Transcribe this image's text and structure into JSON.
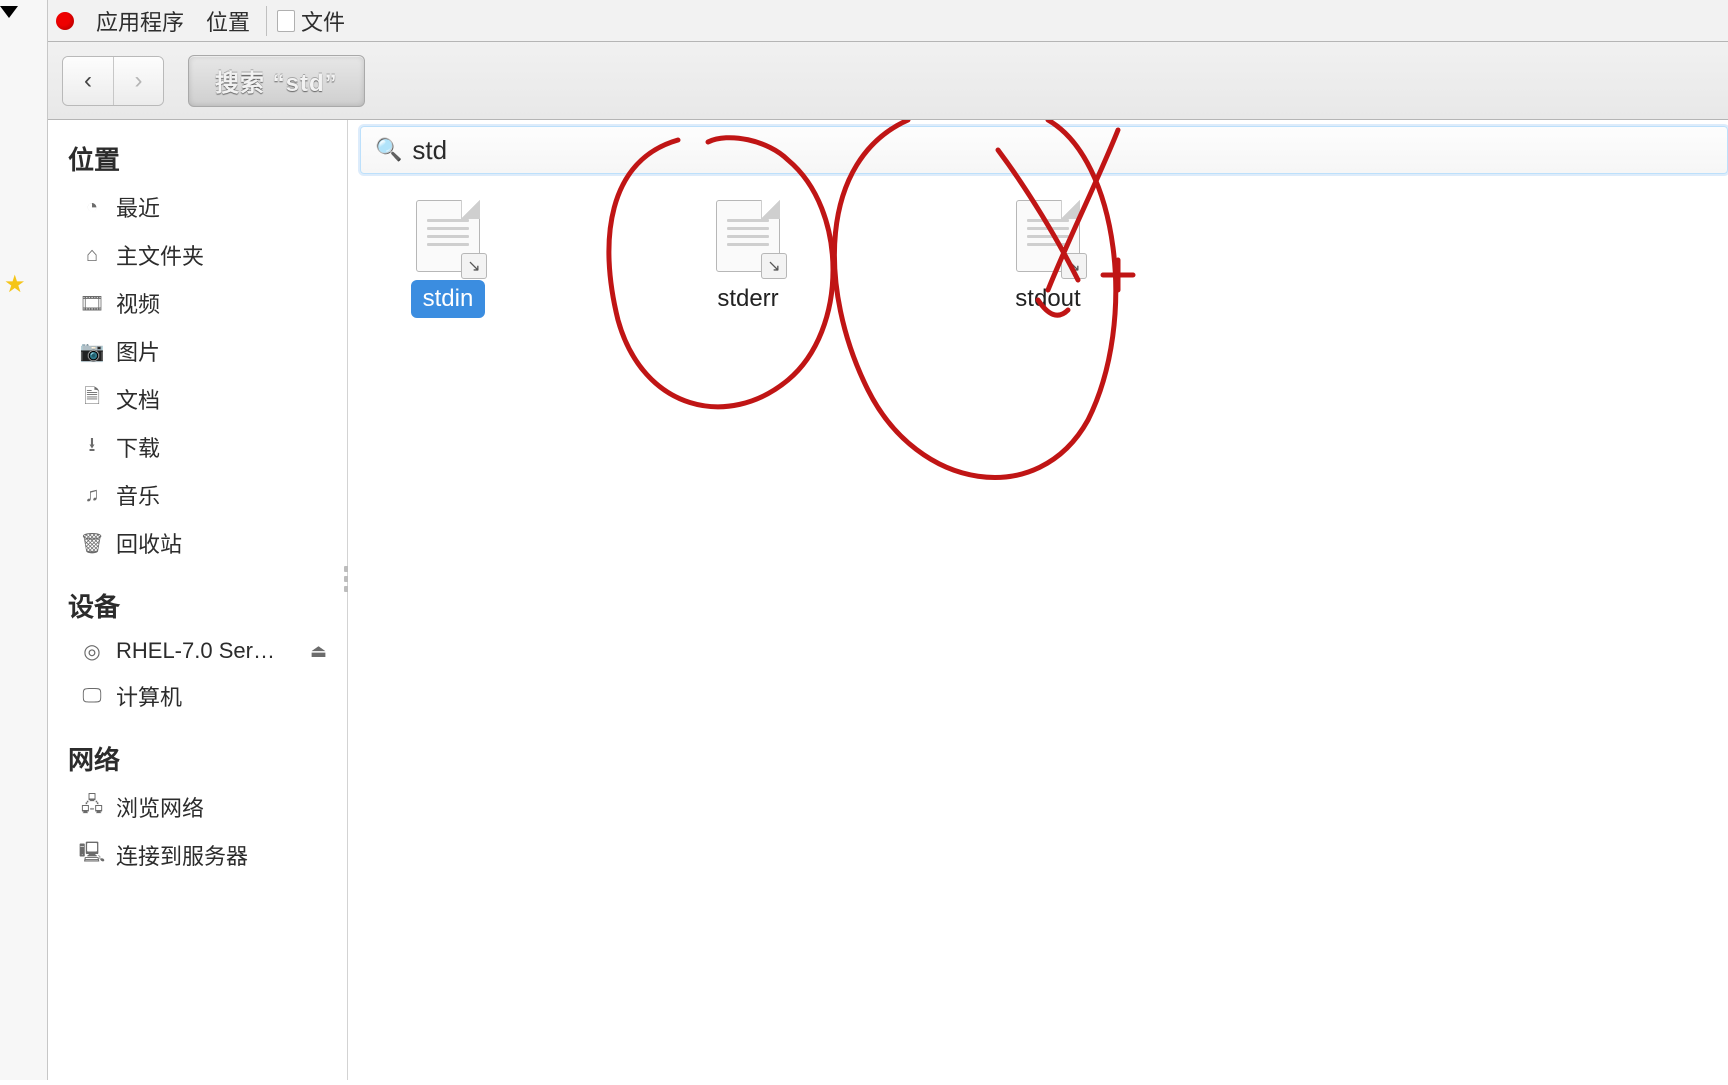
{
  "menubar": {
    "app_menu": "应用程序",
    "places_menu": "位置",
    "window_title": "文件"
  },
  "toolbar": {
    "back_symbol": "‹",
    "forward_symbol": "›",
    "search_label": "搜索 “std”"
  },
  "sidebar": {
    "sections": {
      "places": "位置",
      "devices": "设备",
      "network": "网络"
    },
    "places": [
      {
        "icon": "clock",
        "label": "最近"
      },
      {
        "icon": "home",
        "label": "主文件夹"
      },
      {
        "icon": "video",
        "label": "视频"
      },
      {
        "icon": "camera",
        "label": "图片"
      },
      {
        "icon": "document",
        "label": "文档"
      },
      {
        "icon": "download",
        "label": "下载"
      },
      {
        "icon": "music",
        "label": "音乐"
      },
      {
        "icon": "trash",
        "label": "回收站"
      }
    ],
    "devices": [
      {
        "icon": "disc",
        "label": "RHEL-7.0 Ser…",
        "ejectable": true
      },
      {
        "icon": "computer",
        "label": "计算机"
      }
    ],
    "network": [
      {
        "icon": "browse-net",
        "label": "浏览网络"
      },
      {
        "icon": "server",
        "label": "连接到服务器"
      }
    ]
  },
  "search": {
    "query": "std"
  },
  "files": [
    {
      "name": "stdin",
      "selected": true
    },
    {
      "name": "stderr",
      "selected": false
    },
    {
      "name": "stdout",
      "selected": false
    }
  ],
  "annotations": {
    "cross_marker": "+"
  }
}
